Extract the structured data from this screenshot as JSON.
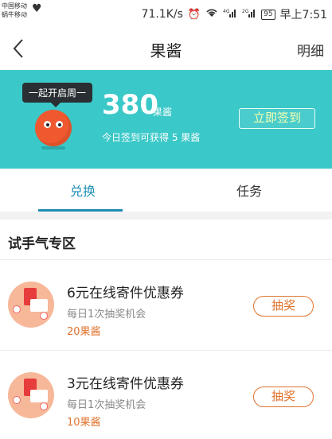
{
  "status_bar": {
    "carrier_line1": "中国移动",
    "carrier_line2": "蜗牛移动",
    "speed": "71.1K/s",
    "alarm_icon": "⏰",
    "wifi_icon": "wifi-icon",
    "signal_4g": "4G",
    "signal_2g": "2G",
    "battery": "95",
    "time": "早上7:51"
  },
  "nav": {
    "title": "果酱",
    "detail_label": "明细"
  },
  "banner": {
    "bubble_text": "一起开启周一",
    "points": "380",
    "points_unit": "果酱",
    "sign_hint": "今日签到可获得 5 果酱",
    "checkin_label": "立即签到",
    "bg_color": "#3bc8c8",
    "mascot_color": "#f0582f"
  },
  "tabs": [
    {
      "label": "兑换",
      "active": true
    },
    {
      "label": "任务",
      "active": false
    }
  ],
  "section": {
    "title": "试手气专区"
  },
  "coupons": [
    {
      "name": "6元在线寄件优惠券",
      "freq": "每日1次抽奖机会",
      "cost": "20果酱",
      "action": "抽奖"
    },
    {
      "name": "3元在线寄件优惠券",
      "freq": "每日1次抽奖机会",
      "cost": "10果酱",
      "action": "抽奖"
    }
  ],
  "colors": {
    "accent": "#1f8fb5",
    "cost": "#e0732e"
  }
}
